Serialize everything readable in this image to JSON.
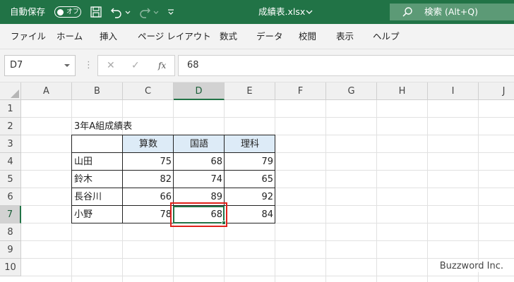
{
  "titlebar": {
    "autosave_label": "自動保存",
    "autosave_state": "オフ",
    "doc_title": "成績表.xlsx",
    "search_placeholder": "検索 (Alt+Q)"
  },
  "menu": {
    "items": [
      "ファイル",
      "ホーム",
      "挿入",
      "ページ レイアウト",
      "数式",
      "データ",
      "校閲",
      "表示",
      "ヘルプ"
    ]
  },
  "formula_bar": {
    "name_box": "D7",
    "formula": "68"
  },
  "grid": {
    "columns": [
      "A",
      "B",
      "C",
      "D",
      "E",
      "F",
      "G",
      "H",
      "I",
      "J"
    ],
    "rows": [
      "1",
      "2",
      "3",
      "4",
      "5",
      "6",
      "7",
      "8",
      "9",
      "10"
    ],
    "active_column": "D",
    "active_row": "7"
  },
  "sheet": {
    "title": "3年A組成績表",
    "headers": [
      "算数",
      "国語",
      "理科"
    ],
    "students": [
      {
        "name": "山田",
        "scores": [
          "75",
          "68",
          "79"
        ]
      },
      {
        "name": "鈴木",
        "scores": [
          "82",
          "74",
          "65"
        ]
      },
      {
        "name": "長谷川",
        "scores": [
          "66",
          "89",
          "92"
        ]
      },
      {
        "name": "小野",
        "scores": [
          "78",
          "68",
          "84"
        ]
      }
    ]
  },
  "watermark": "Buzzword Inc.",
  "colors": {
    "accent": "#217346",
    "header_fill": "#ddebf7",
    "highlight": "#e0211b"
  }
}
